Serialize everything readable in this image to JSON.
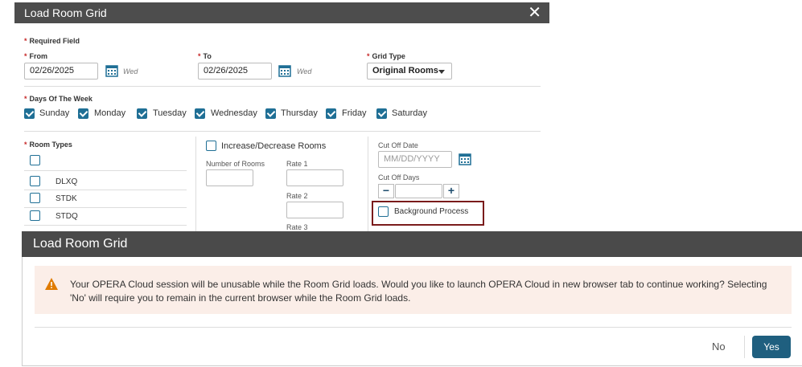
{
  "dialog": {
    "title": "Load Room Grid",
    "required_field": "Required Field",
    "from_label": "From",
    "from_value": "02/26/2025",
    "from_dow": "Wed",
    "to_label": "To",
    "to_value": "02/26/2025",
    "to_dow": "Wed",
    "grid_type_label": "Grid Type",
    "grid_type_value": "Original Rooms",
    "days_label": "Days Of The Week",
    "days": [
      "Sunday",
      "Monday",
      "Tuesday",
      "Wednesday",
      "Thursday",
      "Friday",
      "Saturday"
    ],
    "room_types_label": "Room Types",
    "room_types": [
      "DLXQ",
      "STDK",
      "STDQ"
    ],
    "increase_decrease": "Increase/Decrease Rooms",
    "number_of_rooms": "Number of Rooms",
    "rate1": "Rate 1",
    "rate2": "Rate 2",
    "rate3": "Rate 3",
    "cut_off_date_label": "Cut Off Date",
    "cut_off_date_placeholder": "MM/DD/YYYY",
    "cut_off_days_label": "Cut Off Days",
    "background_process": "Background Process"
  },
  "modal": {
    "title": "Load Room Grid",
    "message": "Your OPERA Cloud session will be unusable while the Room Grid loads. Would you like to launch OPERA Cloud in new browser tab to continue working? Selecting 'No' will require you to remain in the current browser while the Room Grid loads.",
    "no_label": "No",
    "yes_label": "Yes"
  },
  "colors": {
    "accent": "#1f6f95",
    "titlebar": "#4d4d4d",
    "warning": "#e07b00",
    "highlight": "#7a1b1b"
  }
}
